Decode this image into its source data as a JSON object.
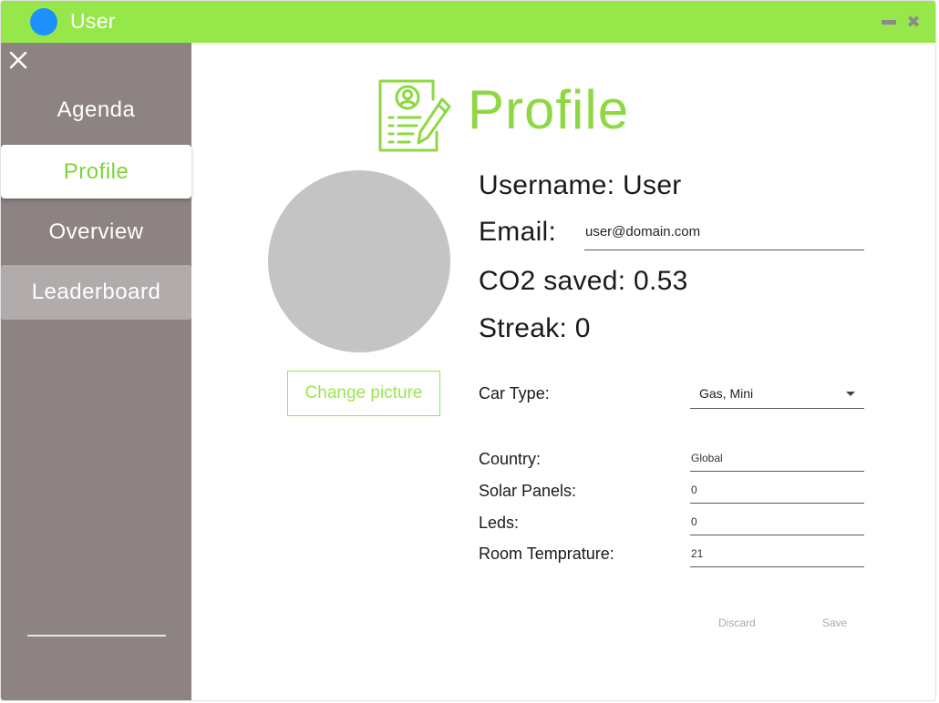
{
  "window": {
    "title": "User",
    "accent_color": "#96e84a",
    "app_dot_color": "#1e90ff"
  },
  "titlebar_controls": {
    "minimize_icon": "minimize-icon",
    "close_icon": "close-icon"
  },
  "sidebar": {
    "background_color": "#8c8382",
    "close_icon": "close-icon",
    "items": [
      {
        "label": "Agenda",
        "state": "normal"
      },
      {
        "label": "Profile",
        "state": "selected"
      },
      {
        "label": "Overview",
        "state": "normal"
      },
      {
        "label": "Leaderboard",
        "state": "hover"
      }
    ]
  },
  "main": {
    "title": "Profile",
    "title_icon": "profile-document-pencil-icon",
    "change_picture_label": "Change picture",
    "username_text": "Username: User",
    "email_label": "Email:",
    "email_value": "user@domain.com",
    "co2_text": "CO2 saved: 0.53",
    "streak_text": "Streak: 0",
    "car_type_label": "Car Type:",
    "car_type_value": "Gas, Mini",
    "country_label": "Country:",
    "country_value": "Global",
    "solar_label": "Solar Panels:",
    "solar_value": "0",
    "leds_label": "Leds:",
    "leds_value": "0",
    "room_label": "Room Temprature:",
    "room_value": "21",
    "discard_label": "Discard",
    "save_label": "Save"
  }
}
